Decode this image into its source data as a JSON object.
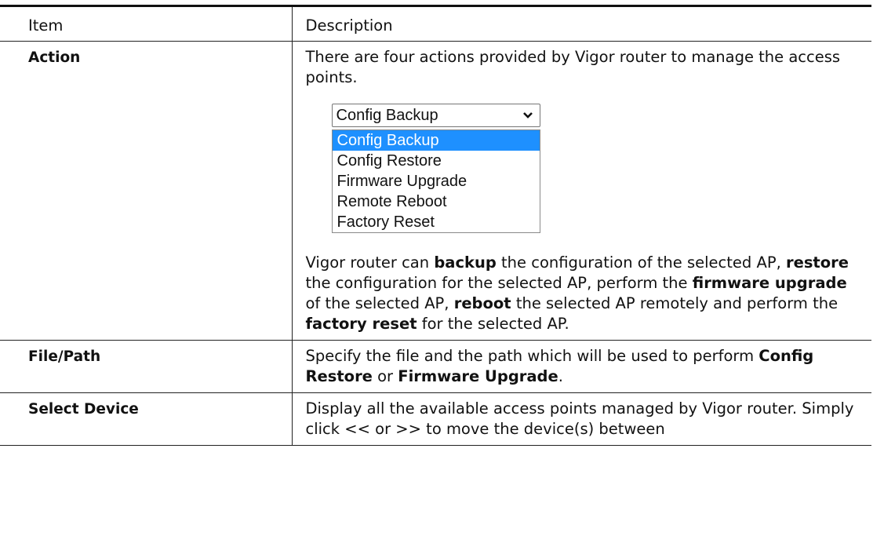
{
  "table": {
    "header": {
      "item": "Item",
      "description": "Description"
    },
    "rows": [
      {
        "item": "Action",
        "intro": "There are four actions provided by Vigor router to manage the access points.",
        "dropdown": {
          "selected": "Config Backup",
          "options": [
            "Config Backup",
            "Config Restore",
            "Firmware Upgrade",
            "Remote Reboot",
            "Factory Reset"
          ]
        },
        "detail": {
          "p1": "Vigor router can ",
          "b1": "backup",
          "p2": " the configuration of the selected AP, ",
          "b2": "restore",
          "p3": " the configuration for the selected AP, perform the ",
          "b3": "firmware upgrade",
          "p4": " of the selected AP, ",
          "b4": "reboot",
          "p5": " the selected AP remotely and perform the ",
          "b5": "factory reset",
          "p6": " for the selected AP."
        }
      },
      {
        "item": "File/Path",
        "p1": "Specify the file and the path which will be used to perform ",
        "b1": "Config Restore",
        "p2": " or ",
        "b2": "Firmware Upgrade",
        "p3": "."
      },
      {
        "item": "Select Device",
        "desc": "Display all the available access points managed by Vigor router. Simply click << or >> to move the device(s) between"
      }
    ]
  },
  "colors": {
    "selected_option_bg": "#1e90ff",
    "border": "#222222"
  },
  "icons": {
    "dropdown_arrow": "chevron-down-icon"
  }
}
